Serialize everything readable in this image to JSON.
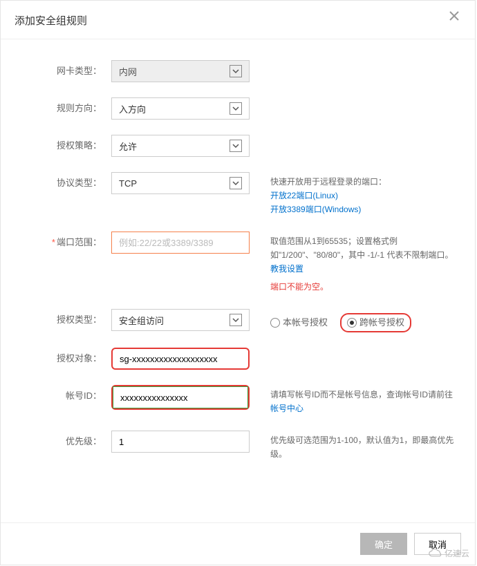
{
  "dialog": {
    "title": "添加安全组规则"
  },
  "form": {
    "nic_type": {
      "label": "网卡类型：",
      "value": "内网"
    },
    "direction": {
      "label": "规则方向：",
      "value": "入方向"
    },
    "policy": {
      "label": "授权策略：",
      "value": "允许"
    },
    "protocol": {
      "label": "协议类型：",
      "value": "TCP"
    },
    "port_range": {
      "label": "端口范围：",
      "placeholder": "例如:22/22或3389/3389"
    },
    "auth_type": {
      "label": "授权类型：",
      "value": "安全组访问"
    },
    "auth_obj": {
      "label": "授权对象：",
      "value": "sg-xxxxxxxxxxxxxxxxxxx"
    },
    "account_id": {
      "label": "帐号ID：",
      "value": "xxxxxxxxxxxxxxx"
    },
    "priority": {
      "label": "优先级：",
      "value": "1"
    }
  },
  "help": {
    "protocol_title": "快速开放用于远程登录的端口：",
    "open_22": "开放22端口(Linux)",
    "open_3389": "开放3389端口(Windows)",
    "port_range_desc": "取值范围从1到65535；设置格式例如\"1/200\"、\"80/80\"，其中 -1/-1 代表不限制端口。",
    "port_range_link": "教我设置",
    "port_range_error": "端口不能为空。",
    "auth_radio_self": "本帐号授权",
    "auth_radio_cross": "跨帐号授权",
    "account_id_desc": "请填写帐号ID而不是帐号信息，查询帐号ID请前往 ",
    "account_id_link": "帐号中心",
    "priority_desc": "优先级可选范围为1-100，默认值为1，即最高优先级。"
  },
  "footer": {
    "confirm": "确定",
    "cancel": "取消"
  },
  "watermark": "亿速云"
}
